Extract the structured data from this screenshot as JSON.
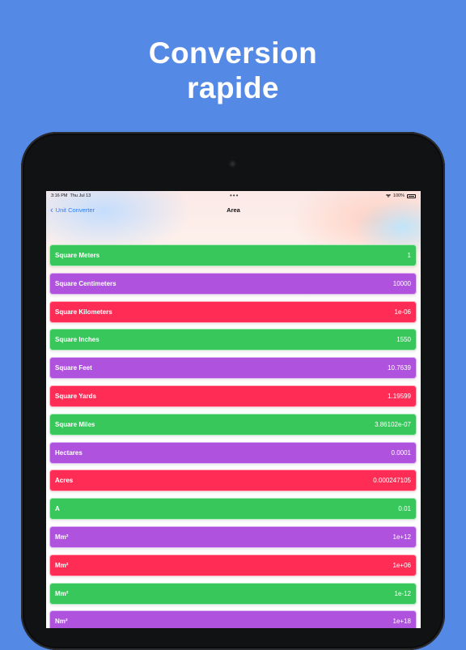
{
  "headline": {
    "line1": "Conversion",
    "line2": "rapide"
  },
  "status": {
    "time": "3:16 PM",
    "date": "Thu Jul 13",
    "battery": "100%"
  },
  "nav": {
    "back_label": "Unit Converter",
    "title": "Area"
  },
  "colors": {
    "green": "#37c75b",
    "purple": "#af52de",
    "red": "#ff2d55",
    "background": "#5589e6",
    "link": "#2f7cf6"
  },
  "rows": [
    {
      "name": "Square Meters",
      "value": "1",
      "color": "#37c75b"
    },
    {
      "name": "Square Centimeters",
      "value": "10000",
      "color": "#af52de"
    },
    {
      "name": "Square Kilometers",
      "value": "1e-06",
      "color": "#ff2d55"
    },
    {
      "name": "Square Inches",
      "value": "1550",
      "color": "#37c75b"
    },
    {
      "name": "Square Feet",
      "value": "10.7639",
      "color": "#af52de"
    },
    {
      "name": "Square Yards",
      "value": "1.19599",
      "color": "#ff2d55"
    },
    {
      "name": "Square Miles",
      "value": "3.86102e-07",
      "color": "#37c75b"
    },
    {
      "name": "Hectares",
      "value": "0.0001",
      "color": "#af52de"
    },
    {
      "name": "Acres",
      "value": "0.000247105",
      "color": "#ff2d55"
    },
    {
      "name": "A",
      "value": "0.01",
      "color": "#37c75b"
    },
    {
      "name": "Mm²",
      "value": "1e+12",
      "color": "#af52de"
    },
    {
      "name": "Mm²",
      "value": "1e+06",
      "color": "#ff2d55"
    },
    {
      "name": "Mm²",
      "value": "1e-12",
      "color": "#37c75b"
    },
    {
      "name": "Nm²",
      "value": "1e+18",
      "color": "#af52de"
    }
  ]
}
